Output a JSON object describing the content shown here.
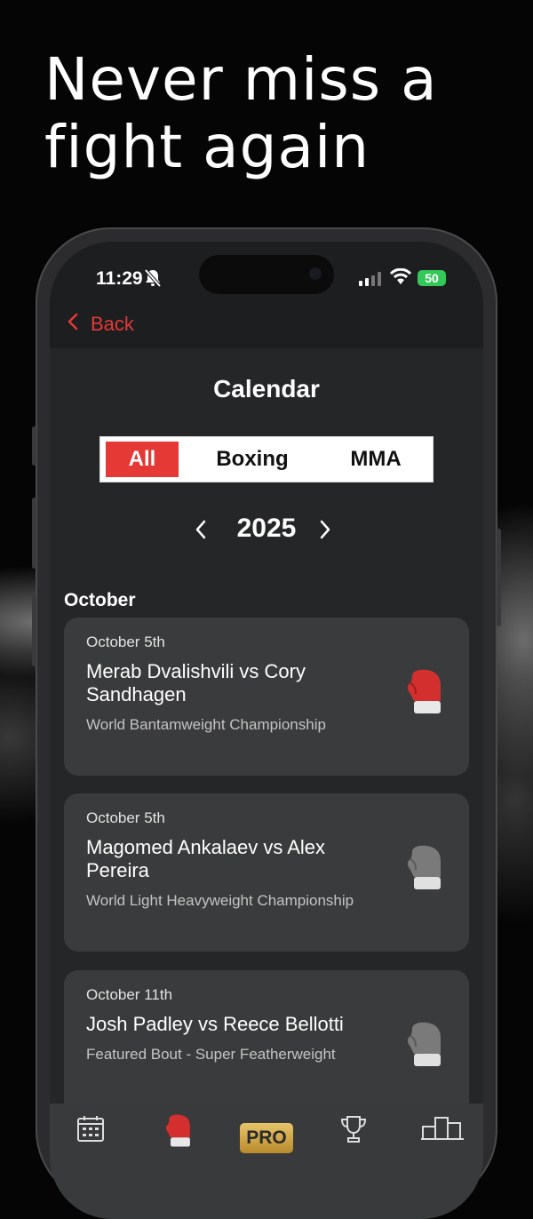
{
  "headline": "Never miss a fight again",
  "status_bar": {
    "time": "11:29",
    "battery": "50"
  },
  "nav": {
    "back_label": "Back"
  },
  "page": {
    "title": "Calendar"
  },
  "segments": {
    "all": "All",
    "boxing": "Boxing",
    "mma": "MMA",
    "selected": "All"
  },
  "year_selector": {
    "year": "2025"
  },
  "month": "October",
  "events": [
    {
      "date": "October 5th",
      "fight": "Merab Dvalishvili vs Cory Sandhagen",
      "subtitle": "World Bantamweight Championship",
      "glove_color": "#d32f2f"
    },
    {
      "date": "October 5th",
      "fight": "Magomed Ankalaev vs Alex Pereira",
      "subtitle": "World Light Heavyweight Championship",
      "glove_color": "#7a7a7a"
    },
    {
      "date": "October 11th",
      "fight": "Josh Padley vs Reece Bellotti",
      "subtitle": "Featured Bout - Super Featherweight",
      "glove_color": "#7a7a7a"
    }
  ],
  "tabbar": {
    "icons": [
      "calendar-icon",
      "glove-icon",
      "pro-badge",
      "trophy-icon",
      "leaderboard-icon"
    ],
    "pro_label": "PRO"
  },
  "colors": {
    "accent": "#e53935",
    "card": "#3a3b3c",
    "background": "#252627"
  }
}
